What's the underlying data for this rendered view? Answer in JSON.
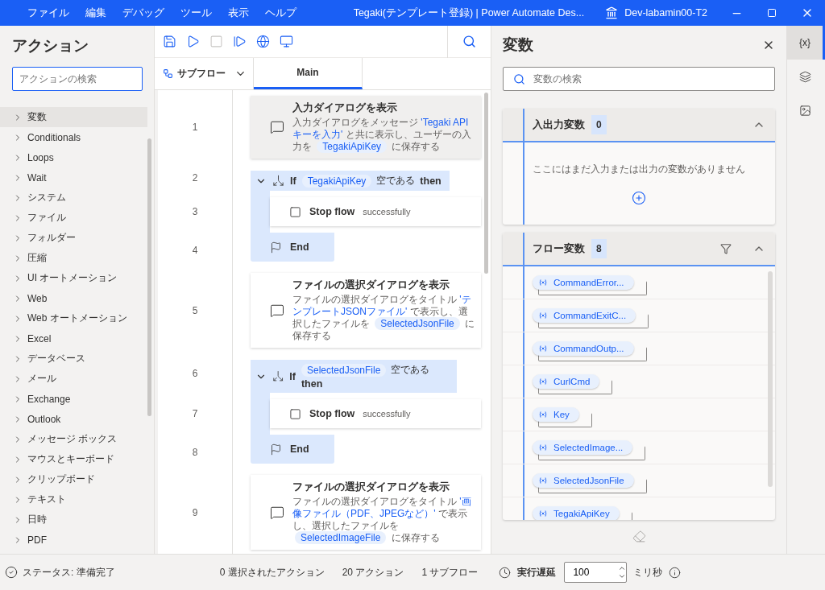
{
  "menu": [
    "ファイル",
    "編集",
    "デバッグ",
    "ツール",
    "表示",
    "ヘルプ"
  ],
  "window": {
    "title": "Tegaki(テンプレート登録) | Power Automate Des...",
    "user": "Dev-labamin00-T2"
  },
  "actions_panel": {
    "title": "アクション",
    "search_placeholder": "アクションの検索",
    "items": [
      {
        "label": "変数",
        "selected": true
      },
      {
        "label": "Conditionals",
        "selected": false
      },
      {
        "label": "Loops",
        "selected": false
      },
      {
        "label": "Wait",
        "selected": false
      },
      {
        "label": "システム",
        "selected": false
      },
      {
        "label": "ファイル",
        "selected": false
      },
      {
        "label": "フォルダー",
        "selected": false
      },
      {
        "label": "圧縮",
        "selected": false
      },
      {
        "label": "UI オートメーション",
        "selected": false
      },
      {
        "label": "Web",
        "selected": false
      },
      {
        "label": "Web オートメーション",
        "selected": false
      },
      {
        "label": "Excel",
        "selected": false
      },
      {
        "label": "データベース",
        "selected": false
      },
      {
        "label": "メール",
        "selected": false
      },
      {
        "label": "Exchange",
        "selected": false
      },
      {
        "label": "Outlook",
        "selected": false
      },
      {
        "label": "メッセージ ボックス",
        "selected": false
      },
      {
        "label": "マウスとキーボード",
        "selected": false
      },
      {
        "label": "クリップボード",
        "selected": false
      },
      {
        "label": "テキスト",
        "selected": false
      },
      {
        "label": "日時",
        "selected": false
      },
      {
        "label": "PDF",
        "selected": false
      }
    ]
  },
  "toolbar": [
    {
      "kind": "save",
      "disabled": false
    },
    {
      "kind": "run",
      "disabled": false
    },
    {
      "kind": "stop",
      "disabled": true
    },
    {
      "kind": "step",
      "disabled": false
    },
    {
      "kind": "web",
      "disabled": false
    },
    {
      "kind": "recorder",
      "disabled": false
    }
  ],
  "subflow_menu": "サブフロー",
  "tabs": [
    {
      "label": "Main",
      "selected": true
    }
  ],
  "flow": [
    {
      "kind": "action",
      "number": "1",
      "selected": true,
      "title": "入力ダイアログを表示",
      "description": [
        {
          "kind": "text",
          "text": "入力ダイアログをメッセージ "
        },
        {
          "kind": "literal",
          "text": "'Tegaki APIキーを入力'"
        },
        {
          "kind": "text",
          "text": " と共に表示し、ユーザーの入力を "
        },
        {
          "kind": "var",
          "text": "TegakiApiKey"
        },
        {
          "kind": "text",
          "text": " に保存する"
        }
      ]
    },
    {
      "kind": "if",
      "number": "2",
      "keyword": "If",
      "variable": "TegakiApiKey",
      "operator": "空である",
      "then": "then",
      "expanded": true,
      "children": [
        {
          "kind": "stop",
          "number": "3",
          "title": "Stop flow",
          "detail": "successfully"
        }
      ],
      "end": {
        "number": "4",
        "label": "End"
      }
    },
    {
      "kind": "action",
      "number": "5",
      "selected": false,
      "title": "ファイルの選択ダイアログを表示",
      "description": [
        {
          "kind": "text",
          "text": "ファイルの選択ダイアログをタイトル "
        },
        {
          "kind": "literal",
          "text": "'テンプレートJSONファイル'"
        },
        {
          "kind": "text",
          "text": " で表示し、選択したファイルを "
        },
        {
          "kind": "var",
          "text": "SelectedJsonFile"
        },
        {
          "kind": "text",
          "text": " に保存する"
        }
      ]
    },
    {
      "kind": "if",
      "number": "6",
      "keyword": "If",
      "variable": "SelectedJsonFile",
      "operator": "空である",
      "then": "then",
      "expanded": true,
      "children": [
        {
          "kind": "stop",
          "number": "7",
          "title": "Stop flow",
          "detail": "successfully"
        }
      ],
      "end": {
        "number": "8",
        "label": "End"
      }
    },
    {
      "kind": "action",
      "number": "9",
      "selected": false,
      "title": "ファイルの選択ダイアログを表示",
      "description": [
        {
          "kind": "text",
          "text": "ファイルの選択ダイアログをタイトル "
        },
        {
          "kind": "literal",
          "text": "'画像ファイル（PDF、JPEGなど）'"
        },
        {
          "kind": "text",
          "text": " で表示し、選択したファイルを "
        },
        {
          "kind": "var",
          "text": "SelectedImageFile"
        },
        {
          "kind": "text",
          "text": " に保存する"
        }
      ]
    }
  ],
  "variables_panel": {
    "title": "変数",
    "search_placeholder": "変数の検索",
    "sections": [
      {
        "title": "入出力変数",
        "count": "0",
        "empty_text": "ここにはまだ入力または出力の変数がありません"
      },
      {
        "title": "フロー変数",
        "count": "8",
        "filter": true,
        "variables": [
          "CommandError...",
          "CommandExitC...",
          "CommandOutp...",
          "CurlCmd",
          "Key",
          "SelectedImage...",
          "SelectedJsonFile",
          "TegakiApiKey"
        ]
      }
    ]
  },
  "side_tabs": [
    {
      "kind": "variables",
      "label": "{x}",
      "selected": true
    },
    {
      "kind": "layers",
      "selected": false
    },
    {
      "kind": "images",
      "selected": false
    }
  ],
  "status_bar": {
    "status": "ステータス: 準備完了",
    "selected_actions": "0 選択されたアクション",
    "actions": "20 アクション",
    "subflows": "1 サブフロー",
    "delay_label": "実行遅延",
    "delay_value": "100",
    "delay_unit": "ミリ秒"
  }
}
